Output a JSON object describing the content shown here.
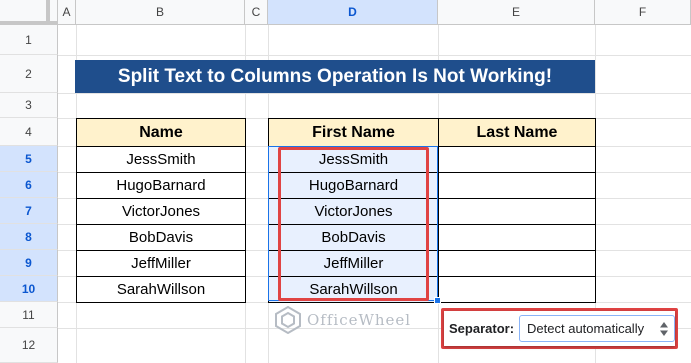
{
  "columns": [
    "A",
    "B",
    "C",
    "D",
    "E",
    "F"
  ],
  "rows": [
    "1",
    "2",
    "3",
    "4",
    "5",
    "6",
    "7",
    "8",
    "9",
    "10",
    "11",
    "12"
  ],
  "title": "Split Text to Columns Operation Is Not Working!",
  "left_table": {
    "header": "Name",
    "values": [
      "JessSmith",
      "HugoBarnard",
      "VictorJones",
      "BobDavis",
      "JeffMiller",
      "SarahWillson"
    ]
  },
  "right_table": {
    "headers": [
      "First Name",
      "Last Name"
    ],
    "values": [
      "JessSmith",
      "HugoBarnard",
      "VictorJones",
      "BobDavis",
      "JeffMiller",
      "SarahWillson"
    ]
  },
  "watermark": "OfficeWheel",
  "separator": {
    "label": "Separator:",
    "selected": "Detect automatically"
  },
  "colors": {
    "title_bg": "#1f4e8c",
    "header_bg": "#fff2cc",
    "highlight": "#e04343",
    "selection": "#1a73e8"
  },
  "icons": {
    "watermark_logo": "officewheel-logo-icon",
    "select_arrow": "up-down-arrows-icon"
  }
}
